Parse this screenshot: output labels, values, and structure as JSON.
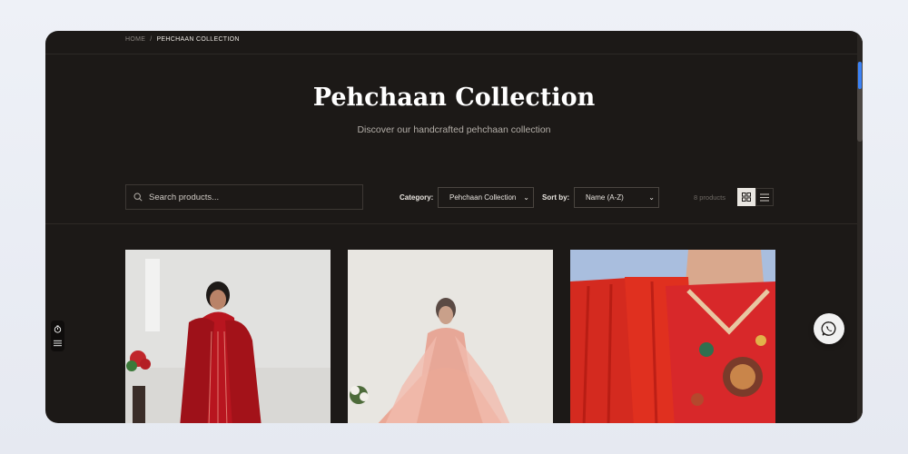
{
  "breadcrumb": {
    "home": "HOME",
    "separator": "/",
    "current": "PEHCHAAN COLLECTION"
  },
  "hero": {
    "title": "Pehchaan Collection",
    "subtitle": "Discover our handcrafted pehchaan collection"
  },
  "filters": {
    "search_placeholder": "Search products...",
    "category_label": "Category:",
    "category_value": "Pehchaan Collection",
    "sort_label": "Sort by:",
    "sort_value": "Name (A-Z)",
    "product_count": "8 products"
  },
  "icons": {
    "search": "search-icon",
    "grid_view": "grid-view-icon",
    "list_view": "list-view-icon",
    "timer": "timer-icon",
    "menu": "menu-icon",
    "whatsapp": "whatsapp-icon"
  },
  "products": [
    {
      "image": "red striped suit with dupatta"
    },
    {
      "image": "peach anarkali with dupatta"
    },
    {
      "image": "red embroidered kurta close-up"
    }
  ],
  "colors": {
    "page_bg": "#1c1917",
    "accent": "#3b82f6",
    "grid_active": "#e9e6e1"
  }
}
